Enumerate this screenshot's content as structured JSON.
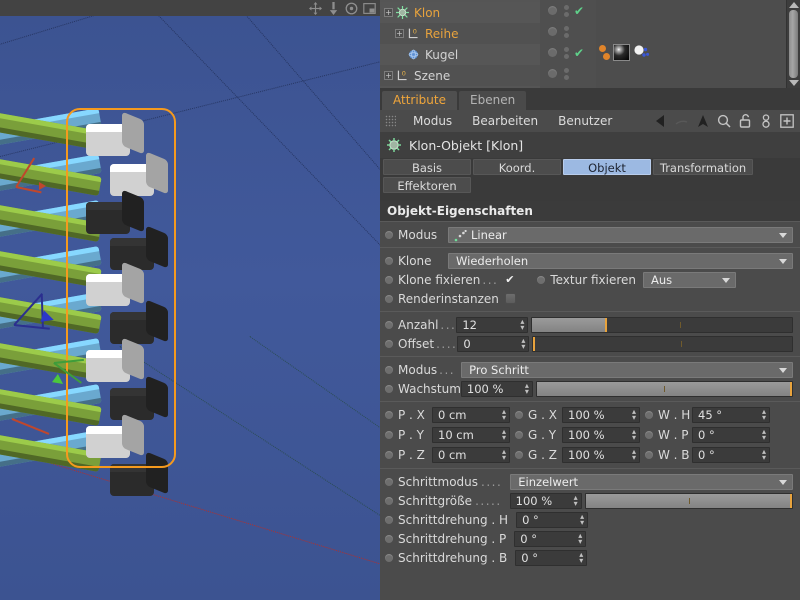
{
  "viewport": {
    "nav_icons": [
      "move-icon",
      "dolly-icon",
      "rotate-icon",
      "maximize-icon"
    ],
    "background_color": "#3f5896",
    "selection_color": "#f59a1e",
    "clone_colors": [
      "#6aa9cf",
      "#7a9f3a",
      "#e4e4e4",
      "#2f2f2f"
    ]
  },
  "object_manager": {
    "items": [
      {
        "name": "Klon",
        "indent": 0,
        "expandable": true,
        "selected": true,
        "icon": "cloner-icon",
        "visible_check": true
      },
      {
        "name": "Reihe",
        "indent": 1,
        "expandable": true,
        "selected": true,
        "icon": "array-icon",
        "visible_check": false
      },
      {
        "name": "Kugel",
        "indent": 1,
        "expandable": false,
        "selected": false,
        "icon": "sphere-icon",
        "visible_check": true
      },
      {
        "name": "Szene",
        "indent": 0,
        "expandable": true,
        "selected": false,
        "icon": "array-icon",
        "visible_check": false
      }
    ],
    "tags_row_index": 2,
    "tag_icons": [
      "material-tag-icon",
      "texture-tag-icon"
    ]
  },
  "panel_tabs": [
    {
      "label": "Attribute",
      "active": true
    },
    {
      "label": "Ebenen",
      "active": false
    }
  ],
  "menu": {
    "grip": "drag-grip-icon",
    "items": [
      "Modus",
      "Bearbeiten",
      "Benutzer"
    ],
    "icons": [
      "back-arrow-icon",
      "forward-arrow-icon",
      "up-arrow-icon",
      "search-icon",
      "unlock-icon",
      "link-icon",
      "add-icon"
    ]
  },
  "object_header": {
    "icon": "cloner-icon",
    "title": "Klon-Objekt [Klon]"
  },
  "attribute_tabs": {
    "row1": [
      {
        "label": "Basis",
        "selected": false
      },
      {
        "label": "Koord.",
        "selected": false
      },
      {
        "label": "Objekt",
        "selected": true
      },
      {
        "label": "Transformation",
        "selected": false
      }
    ],
    "row2": [
      {
        "label": "Effektoren",
        "selected": false
      }
    ]
  },
  "properties": {
    "section_title": "Objekt-Eigenschaften",
    "mode": {
      "label": "Modus",
      "value": "Linear",
      "icon": "linear-mode-icon"
    },
    "clones": {
      "label": "Klone",
      "value": "Wiederholen"
    },
    "fix_clones": {
      "label": "Klone fixieren",
      "dots": "...",
      "checked": true
    },
    "fix_texture": {
      "label": "Textur fixieren",
      "value": "Aus"
    },
    "render_instances": {
      "label": "Renderinstanzen",
      "checked": false
    },
    "count": {
      "label": "Anzahl",
      "dots": "...",
      "value": "12",
      "fill_pct": 28,
      "tick_pct": 57
    },
    "offset": {
      "label": "Offset",
      "dots": "....",
      "value": "0",
      "fill_pct": 0,
      "tick_pct": 57
    },
    "step_mode": {
      "label": "Modus",
      "dots": "...",
      "value": "Pro Schritt"
    },
    "growth": {
      "label": "Wachstum",
      "value": "100 %",
      "fill_pct": 100,
      "tick_pct": 50
    },
    "transform_rows": [
      {
        "p_label": "P . X",
        "p_value": "0 cm",
        "g_label": "G . X",
        "g_value": "100 %",
        "w_label": "W . H",
        "w_value": "45 °"
      },
      {
        "p_label": "P . Y",
        "p_value": "10 cm",
        "g_label": "G . Y",
        "g_value": "100 %",
        "w_label": "W . P",
        "w_value": "0 °"
      },
      {
        "p_label": "P . Z",
        "p_value": "0 cm",
        "g_label": "G . Z",
        "g_value": "100 %",
        "w_label": "W . B",
        "w_value": "0 °"
      }
    ],
    "step_rows": {
      "step_mode": {
        "label": "Schrittmodus",
        "dots": "....",
        "value": "Einzelwert"
      },
      "step_size": {
        "label": "Schrittgröße",
        "dots": ".....",
        "value": "100 %",
        "fill_pct": 100,
        "tick_pct": 50
      },
      "step_rot": [
        {
          "label": "Schrittdrehung . H",
          "value": "0 °"
        },
        {
          "label": "Schrittdrehung . P",
          "value": "0 °"
        },
        {
          "label": "Schrittdrehung . B",
          "value": "0 °"
        }
      ]
    }
  }
}
